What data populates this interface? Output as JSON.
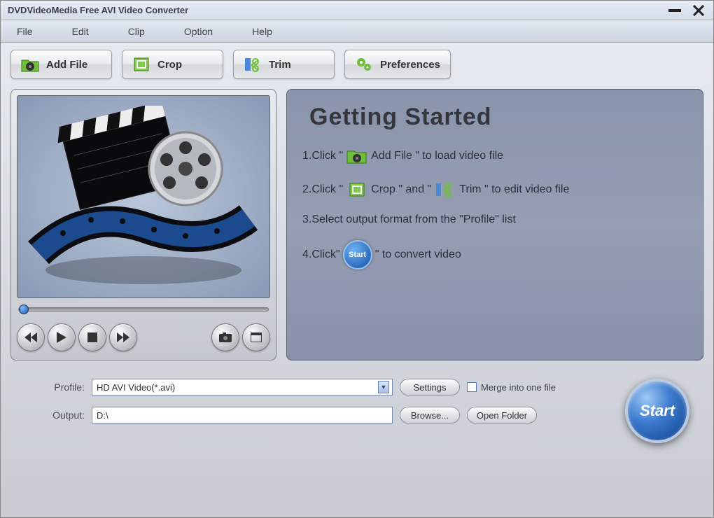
{
  "window": {
    "title": "DVDVideoMedia Free AVI Video Converter"
  },
  "menu": [
    "File",
    "Edit",
    "Clip",
    "Option",
    "Help"
  ],
  "toolbar": {
    "add_file": "Add File",
    "crop": "Crop",
    "trim": "Trim",
    "preferences": "Preferences"
  },
  "guide": {
    "title": "Getting Started",
    "step1_a": "1.Click \"",
    "step1_b": "Add File \" to load video file",
    "step2_a": "2.Click \"",
    "step2_b": "Crop \" and \"",
    "step2_c": "Trim \" to edit video file",
    "step3": "3.Select output format from the \"Profile\" list",
    "step4_a": "4.Click\"",
    "step4_b": "\" to convert video",
    "start_badge": "Start"
  },
  "form": {
    "profile_label": "Profile:",
    "profile_value": "HD AVI Video(*.avi)",
    "output_label": "Output:",
    "output_value": "D:\\",
    "settings_btn": "Settings",
    "browse_btn": "Browse...",
    "open_folder_btn": "Open Folder",
    "merge_label": "Merge into one file"
  },
  "start_button": "Start"
}
